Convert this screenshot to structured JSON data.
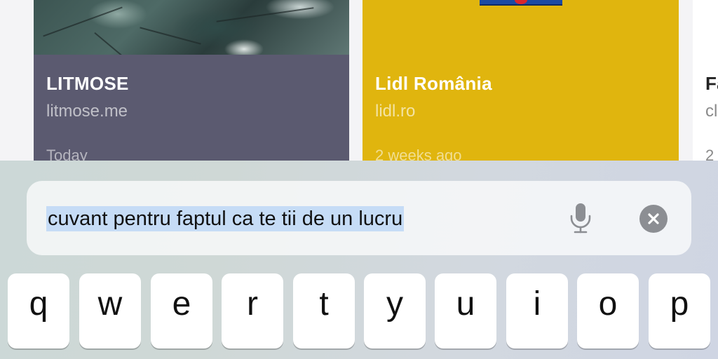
{
  "cards": [
    {
      "title": "LITMOSE",
      "domain": "litmose.me",
      "date": "Today"
    },
    {
      "title": "Lidl România",
      "domain": "lidl.ro",
      "date": "2 weeks ago"
    },
    {
      "title": "Fa",
      "domain": "cl",
      "date": "2"
    }
  ],
  "search": {
    "query": "cuvant pentru faptul ca te tii de un lucru",
    "mic_icon": "microphone-icon",
    "clear_icon": "clear-circle-icon"
  },
  "keyboard": {
    "row1": [
      "q",
      "w",
      "e",
      "r",
      "t",
      "y",
      "u",
      "i",
      "o",
      "p"
    ]
  },
  "colors": {
    "litmose_card": "#5b5a70",
    "lidl_card": "#e0b50e",
    "selection": "#c6dcf6"
  }
}
